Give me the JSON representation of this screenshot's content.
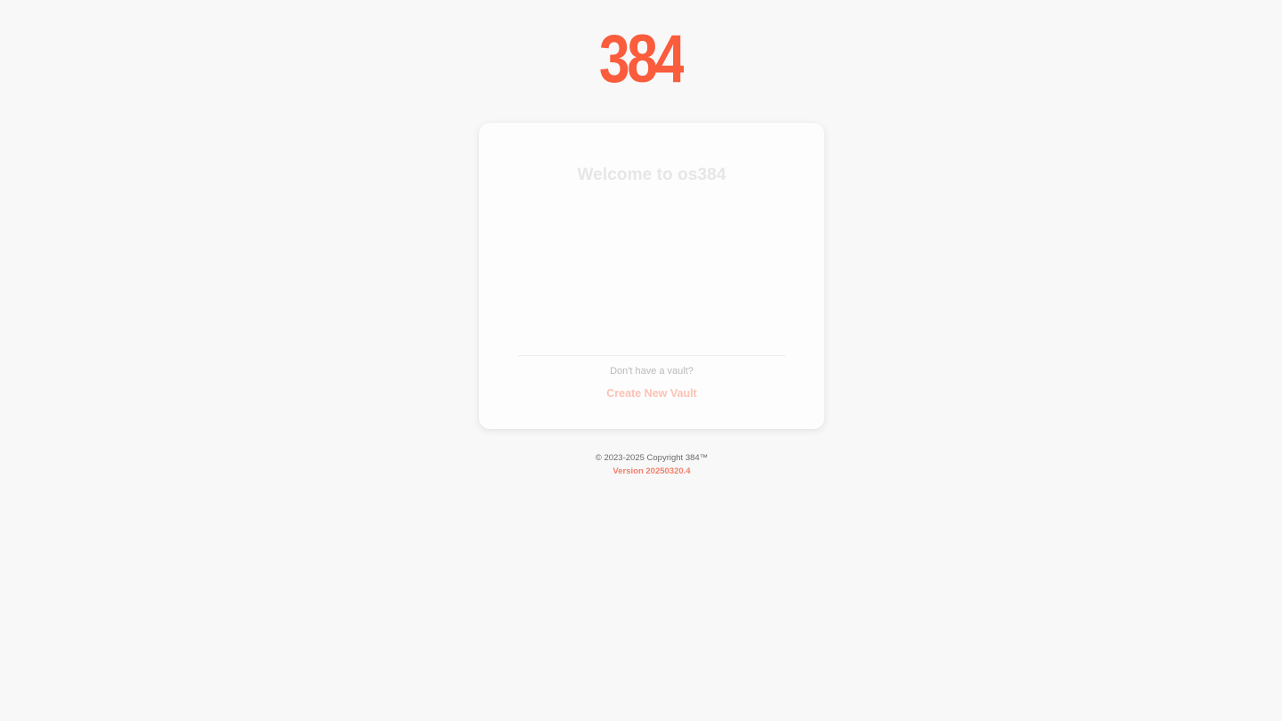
{
  "brand": {
    "logo_text": "384",
    "accent_color": "#fa5c3c"
  },
  "card": {
    "title": "Welcome to os384",
    "prompt": "Don't have a vault?",
    "create_label": "Create New Vault"
  },
  "footer": {
    "copyright": "© 2023-2025 Copyright 384™",
    "version": "Version 20250320.4"
  }
}
